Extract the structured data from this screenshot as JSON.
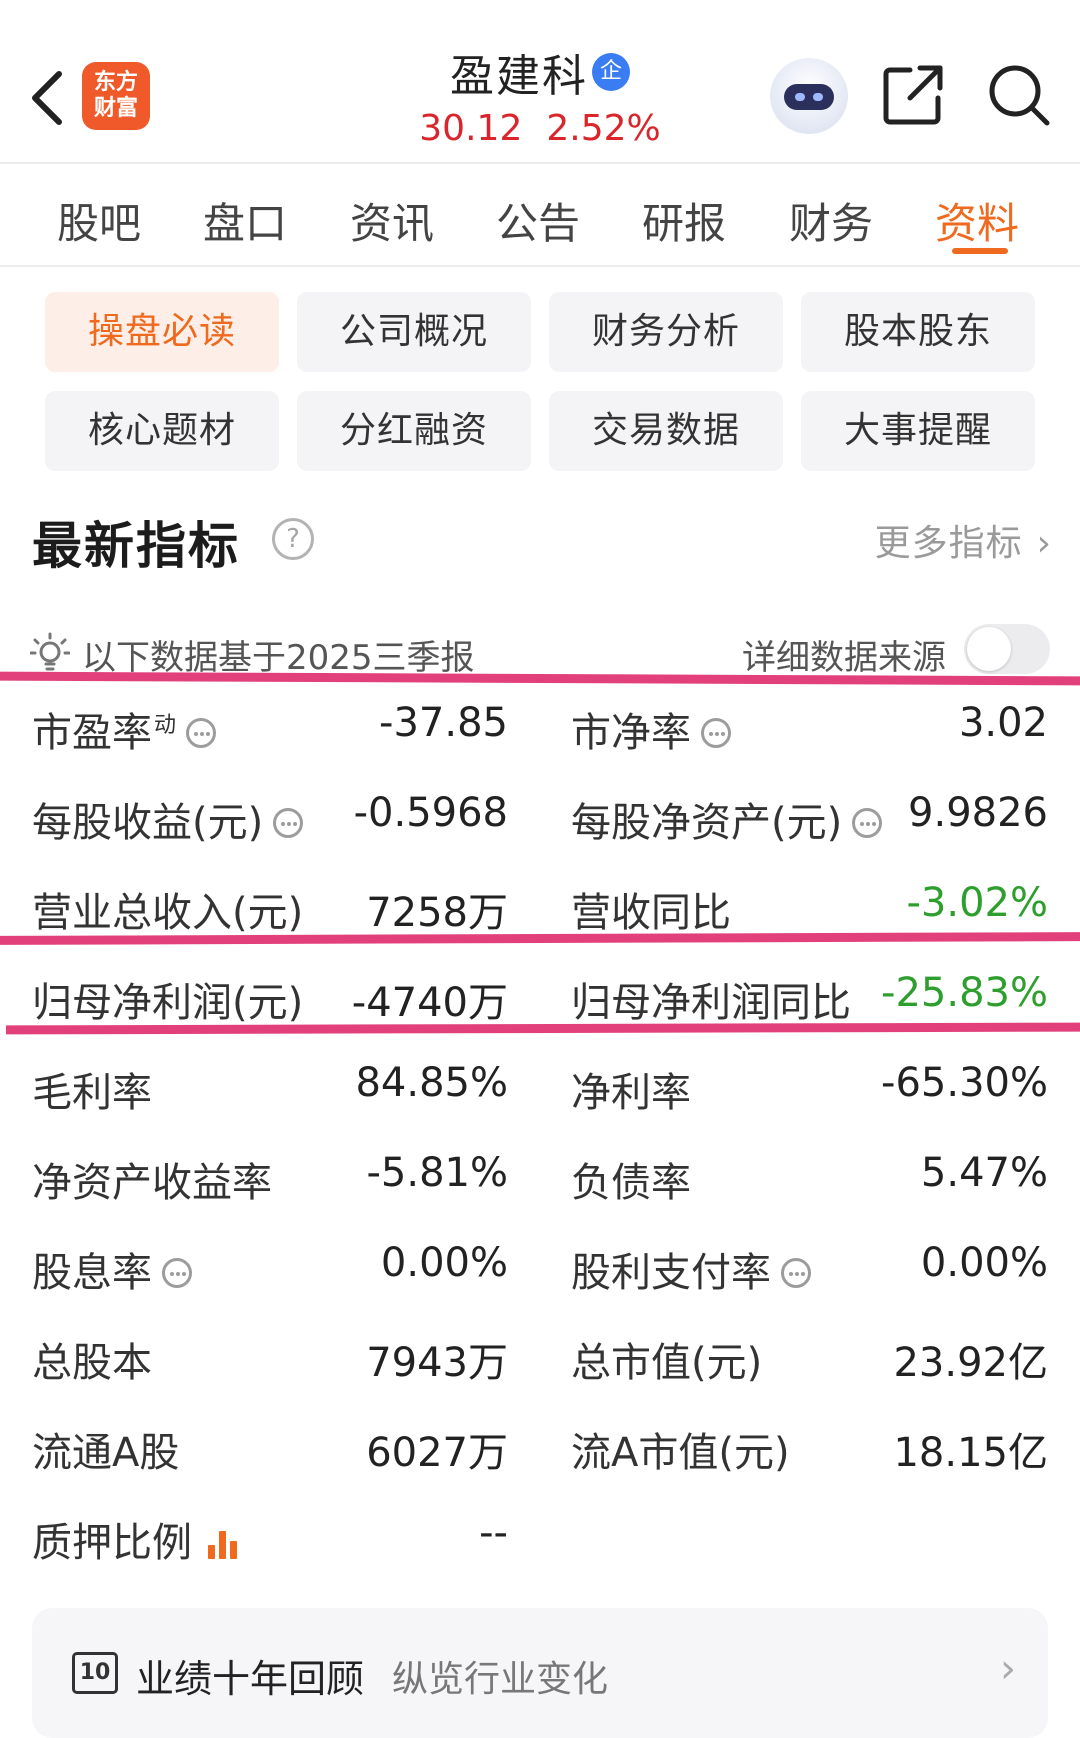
{
  "header": {
    "logo_line1": "东方",
    "logo_line2": "财富",
    "stock_name": "盈建科",
    "badge": "企",
    "price": "30.12",
    "change_pct": "2.52%"
  },
  "tabs": [
    {
      "label": "股吧"
    },
    {
      "label": "盘口"
    },
    {
      "label": "资讯"
    },
    {
      "label": "公告"
    },
    {
      "label": "研报"
    },
    {
      "label": "财务"
    },
    {
      "label": "资料",
      "active": true
    }
  ],
  "categories": [
    {
      "label": "操盘必读",
      "active": true
    },
    {
      "label": "公司概况"
    },
    {
      "label": "财务分析"
    },
    {
      "label": "股本股东"
    },
    {
      "label": "核心题材"
    },
    {
      "label": "分红融资"
    },
    {
      "label": "交易数据"
    },
    {
      "label": "大事提醒"
    }
  ],
  "section": {
    "title": "最新指标",
    "help": "?",
    "more_label": "更多指标",
    "more_chevron": "›",
    "basis_text": "以下数据基于2025三季报",
    "source_label": "详细数据来源"
  },
  "metrics": [
    {
      "label": "市盈率",
      "sup": "动",
      "value": "-37.85"
    },
    {
      "label": "市净率",
      "value": "3.02"
    },
    {
      "label": "每股收益(元)",
      "value": "-0.5968"
    },
    {
      "label": "每股净资产(元)",
      "value": "9.9826"
    },
    {
      "label": "营业总收入(元)",
      "value": "7258万"
    },
    {
      "label": "营收同比",
      "value": "-3.02%"
    },
    {
      "label": "归母净利润(元)",
      "value": "-4740万"
    },
    {
      "label": "归母净利润同比",
      "value": "-25.83%"
    },
    {
      "label": "毛利率",
      "value": "84.85%"
    },
    {
      "label": "净利率",
      "value": "-65.30%"
    },
    {
      "label": "净资产收益率",
      "value": "-5.81%"
    },
    {
      "label": "负债率",
      "value": "5.47%"
    },
    {
      "label": "股息率",
      "value": "0.00%"
    },
    {
      "label": "股利支付率",
      "value": "0.00%"
    },
    {
      "label": "总股本",
      "value": "7943万"
    },
    {
      "label": "总市值(元)",
      "value": "23.92亿"
    },
    {
      "label": "流通A股",
      "value": "6027万"
    },
    {
      "label": "流A市值(元)",
      "value": "18.15亿"
    },
    {
      "label": "质押比例",
      "value": "--"
    }
  ],
  "review_card": {
    "icon_text": "10",
    "title": "业绩十年回顾",
    "subtitle": "纵览行业变化",
    "chevron": "›"
  },
  "colors": {
    "accent": "#ef6a1f",
    "price_up": "#d9252b",
    "negative_change": "#2e9f2e",
    "highlight_marker": "#e2407a"
  },
  "icons": [
    "back-arrow-icon",
    "share-icon",
    "search-icon",
    "robot-assistant-icon",
    "lightbulb-icon",
    "more-dots-icon",
    "bar-chart-icon",
    "help-icon",
    "ten-year-icon"
  ]
}
